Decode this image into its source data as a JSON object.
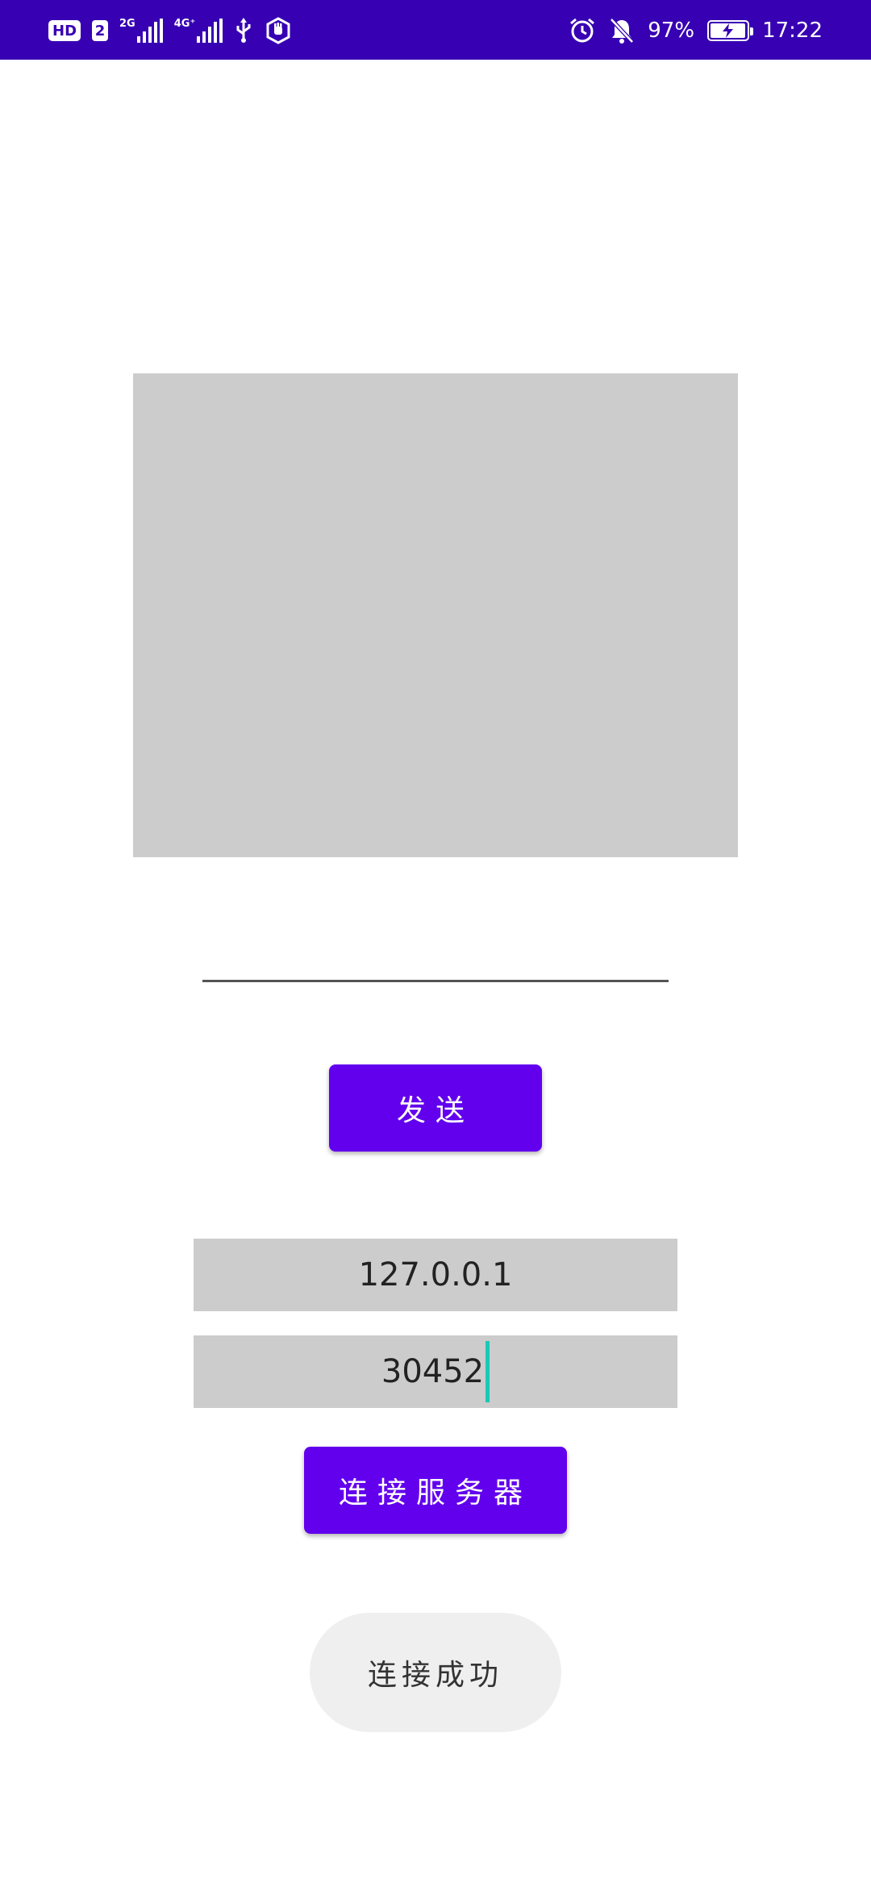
{
  "status_bar": {
    "hd_label": "HD",
    "sim_label": "2",
    "net1_label": "2G",
    "net2_label": "4G⁺",
    "battery_percent": "97%",
    "battery_level": 0.97,
    "time": "17:22",
    "background_color": "#3700b3",
    "icons": [
      "usb-icon",
      "hand-shield-icon",
      "alarm-icon",
      "notifications-off-icon",
      "battery-charging-icon"
    ]
  },
  "main": {
    "message_input": {
      "value": "",
      "placeholder": ""
    },
    "send_button_label": "发送",
    "ip_field_value": "127.0.0.1",
    "port_field_value": "30452",
    "connect_button_label": "连接服务器",
    "status_message": "连接成功",
    "accent_color": "#6200ee",
    "cursor_color": "#1ac8b4"
  }
}
